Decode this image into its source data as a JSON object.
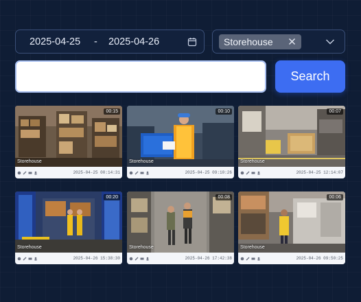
{
  "filters": {
    "date_start": "2025-04-25",
    "date_separator": "-",
    "date_end": "2025-04-26",
    "selected_tag": "Storehouse"
  },
  "search": {
    "placeholder": "",
    "value": "",
    "button_label": "Search"
  },
  "results": [
    {
      "duration": "00:15",
      "location": "Storehouse",
      "timestamp": "2025-04-25 00:14:31"
    },
    {
      "duration": "00:10",
      "location": "Storehouse",
      "timestamp": "2025-04-25 09:10:26"
    },
    {
      "duration": "00:07",
      "location": "Storehouse",
      "timestamp": "2025-04-25 12:14:07"
    },
    {
      "duration": "00:20",
      "location": "Storehouse",
      "timestamp": "2025-04-26 15:38:30"
    },
    {
      "duration": "00:08",
      "location": "Storehouse",
      "timestamp": "2025-04-26 17:42:38"
    },
    {
      "duration": "00:06",
      "location": "Storehouse",
      "timestamp": "2025-04-26 09:50:25"
    }
  ],
  "colors": {
    "background": "#0f1d35",
    "accent": "#3d6df2",
    "tag": "#5a6478"
  },
  "icons": [
    "calendar-icon",
    "close-icon",
    "chevron-down-icon",
    "tool-icon",
    "wrench-icon",
    "vehicle-icon",
    "person-icon"
  ]
}
